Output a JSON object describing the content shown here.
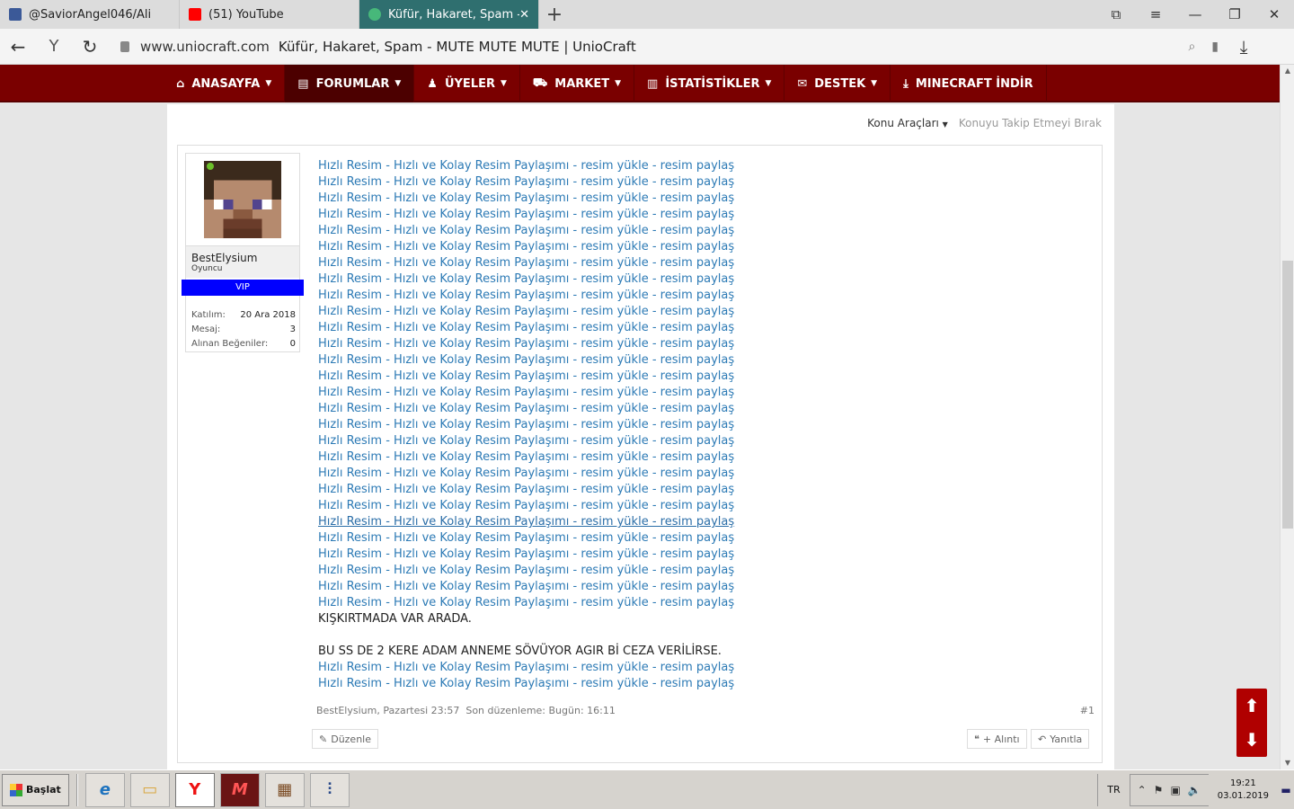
{
  "browser": {
    "tabs": [
      {
        "title": "@SaviorAngel046/Ali",
        "favicon_color": "#3b5998",
        "active": false
      },
      {
        "title": "(51) YouTube",
        "favicon_color": "#ff0000",
        "active": false
      },
      {
        "title": "Küfür, Hakaret, Spam - M",
        "favicon_color": "#47b87a",
        "active": true
      }
    ],
    "url_domain": "www.uniocraft.com",
    "page_title": "Küfür, Hakaret, Spam - MUTE MUTE MUTE | UnioCraft",
    "nav_icons": {
      "back": "back-arrow-icon",
      "yandex": "yandex-icon",
      "reload": "reload-icon"
    }
  },
  "site_nav": {
    "items": [
      {
        "label": "ANASAYFA",
        "icon": "⌂",
        "caret": true
      },
      {
        "label": "FORUMLAR",
        "icon": "▤",
        "caret": true
      },
      {
        "label": "ÜYELER",
        "icon": "👤",
        "caret": true
      },
      {
        "label": "MARKET",
        "icon": "🛒",
        "caret": true
      },
      {
        "label": "İSTATİSTİKLER",
        "icon": "▥",
        "caret": true
      },
      {
        "label": "DESTEK",
        "icon": "✉",
        "caret": true
      },
      {
        "label": "MINECRAFT İNDİR",
        "icon": "⤓",
        "caret": false
      }
    ]
  },
  "thread_tools": {
    "tools_label": "Konu Araçları",
    "unwatch_label": "Konuyu Takip Etmeyi Bırak"
  },
  "post": {
    "user": {
      "name": "BestElysium",
      "title": "Oyuncu",
      "badge": "VIP",
      "stats": [
        {
          "label": "Katılım:",
          "value": "20 Ara 2018"
        },
        {
          "label": "Mesaj:",
          "value": "3"
        },
        {
          "label": "Alınan Beğeniler:",
          "value": "0"
        }
      ]
    },
    "repeated_link_text": "Hızlı Resim - Hızlı ve Kolay Resim Paylaşımı - resim yükle - resim paylaş",
    "text_1": "KIŞKIRTMADA VAR ARADA.",
    "text_2": "BU SS DE 2 KERE ADAM ANNEME SÖVÜYOR AGIR Bİ CEZA VERİLİRSE.",
    "meta_author": "BestElysium",
    "meta_date": "Pazartesi 23:57",
    "meta_edited": "Son düzenleme: Bugün: 16:11",
    "number": "#1",
    "edit_label": "Düzenle",
    "quote_label": "+ Alıntı",
    "reply_label": "Yanıtla"
  },
  "taskbar": {
    "start_label": "Başlat",
    "lang": "TR",
    "time": "19:21",
    "date": "03.01.2019"
  }
}
